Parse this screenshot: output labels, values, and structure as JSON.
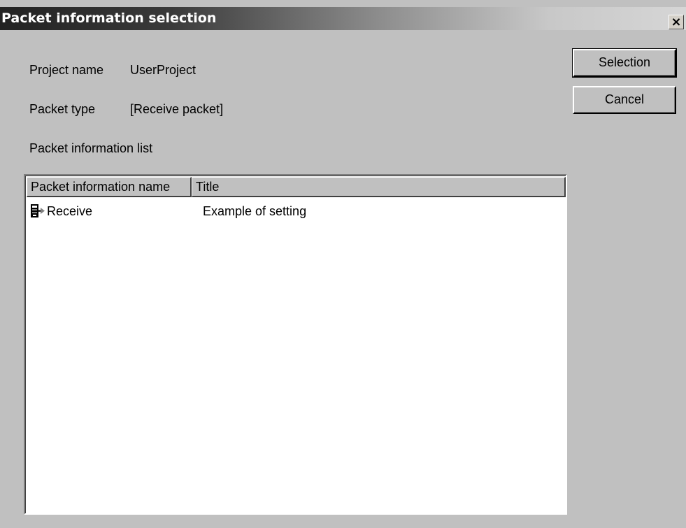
{
  "window": {
    "title": "Packet information selection",
    "close_symbol": "×"
  },
  "fields": {
    "project_name_label": "Project name",
    "project_name_value": "UserProject",
    "packet_type_label": "Packet type",
    "packet_type_value": "[Receive packet]",
    "list_label": "Packet information list"
  },
  "buttons": {
    "selection": "Selection",
    "cancel": "Cancel"
  },
  "list": {
    "columns": [
      "Packet information name",
      "Title"
    ],
    "rows": [
      {
        "icon": "receive-packet-icon",
        "name": "Receive",
        "title": "Example of setting"
      }
    ]
  }
}
